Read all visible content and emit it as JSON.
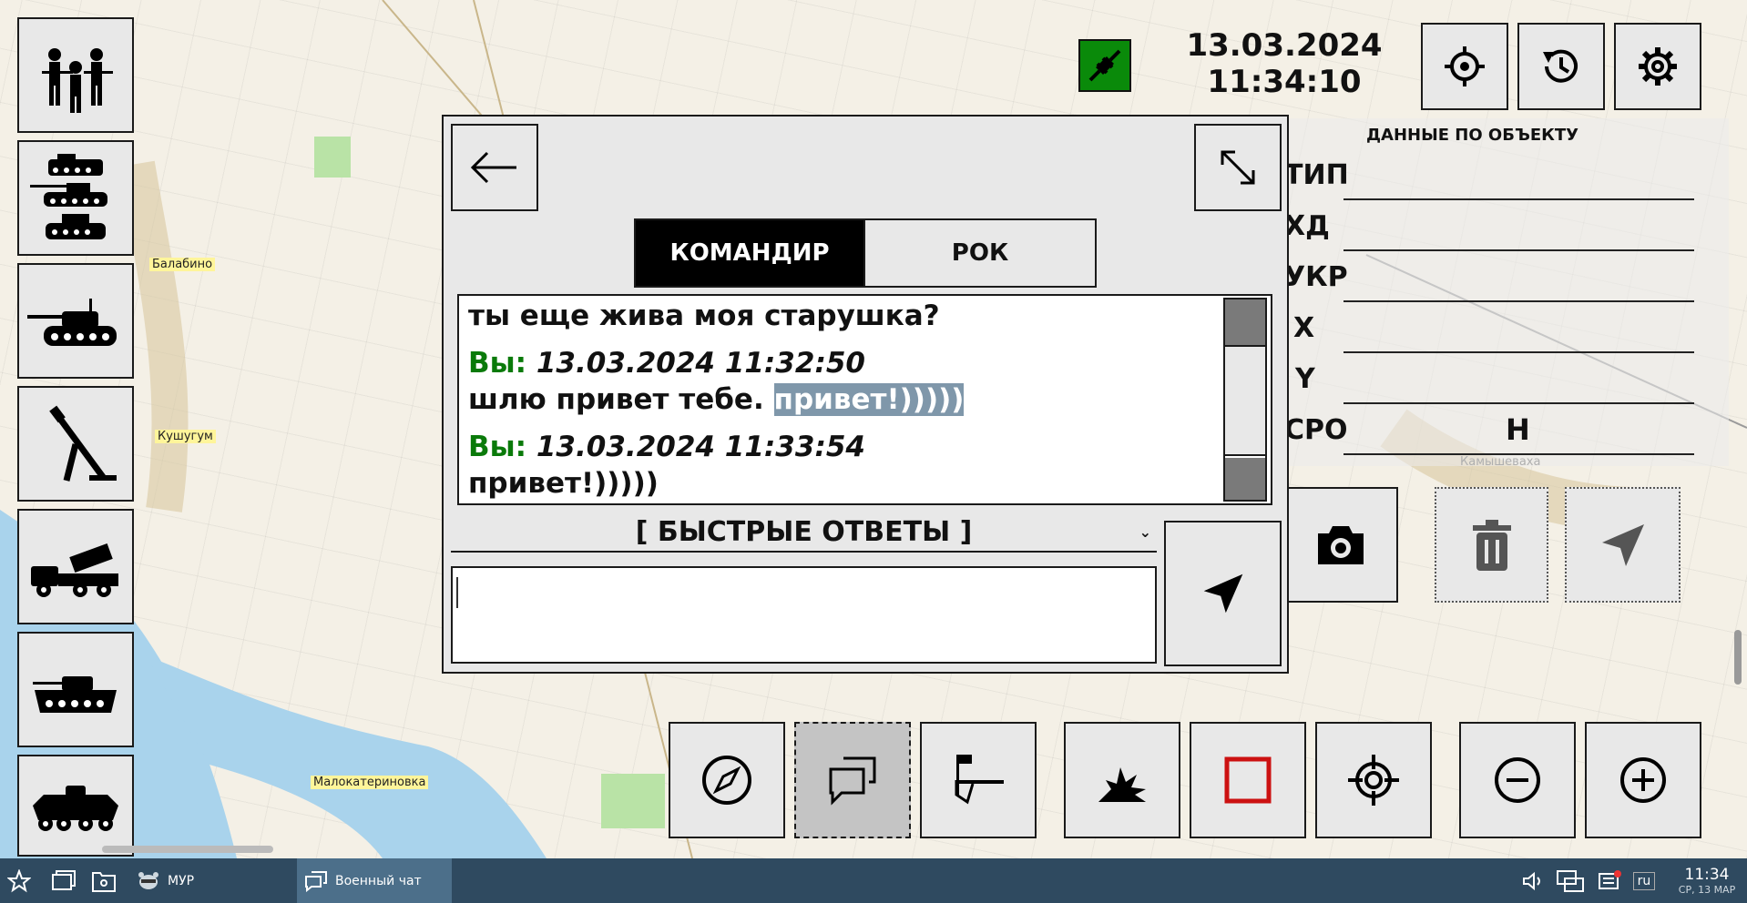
{
  "map": {
    "places": [
      "Балабино",
      "Кушугум",
      "Малокатериновка",
      "Камышеваха"
    ]
  },
  "unit_bar": {
    "icons": [
      "soldiers-group-icon",
      "armored-vehicles-group-icon",
      "tank-icon",
      "mortar-icon",
      "rocket-launcher-truck-icon",
      "bmp-icon",
      "btr-icon"
    ]
  },
  "header": {
    "date": "13.03.2024",
    "time": "11:34:10",
    "connection_color": "#0a8a0a"
  },
  "object_panel": {
    "title": "ДАННЫЕ ПО ОБЪЕКТУ",
    "fields": [
      {
        "label": "ТИП",
        "value": ""
      },
      {
        "label": "ХД",
        "value": ""
      },
      {
        "label": "УКР",
        "value": ""
      },
      {
        "label": "X",
        "value": ""
      },
      {
        "label": "Y",
        "value": ""
      },
      {
        "label": "СРО",
        "value": "Н"
      }
    ]
  },
  "chat": {
    "tabs": [
      {
        "label": "КОМАНДИР",
        "active": true
      },
      {
        "label": "РОК",
        "active": false
      }
    ],
    "first_line": "ты еще жива моя старушка?",
    "messages": [
      {
        "sender": "Вы:",
        "timestamp": "13.03.2024 11:32:50",
        "text": "шлю привет тебе. ",
        "highlight": "привет!)))))"
      },
      {
        "sender": "Вы:",
        "timestamp": "13.03.2024 11:33:54",
        "text": "привет!)))))"
      }
    ],
    "quick_replies_label": "[ БЫСТРЫЕ ОТВЕТЫ ]",
    "input_value": ""
  },
  "taskbar": {
    "apps": [
      {
        "label": "МУР"
      },
      {
        "label": "Военный чат"
      }
    ],
    "language": "ru",
    "time": "11:34",
    "date": "СР, 13 МАР"
  },
  "colors": {
    "accent_green": "#0a7a0a",
    "highlight": "#7f97aa",
    "red_square": "#cc1111",
    "taskbar": "#2f4a60"
  }
}
